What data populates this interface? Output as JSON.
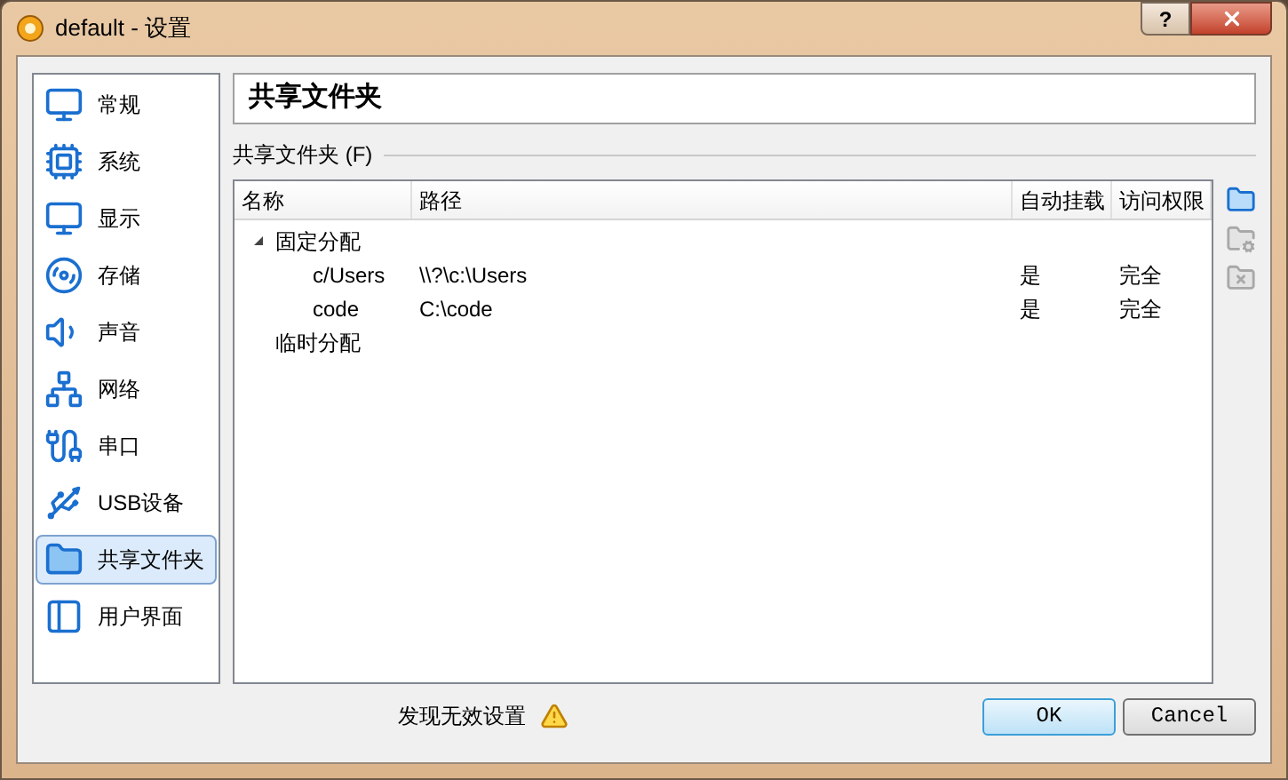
{
  "window": {
    "title": "default - 设置",
    "help_button": "?"
  },
  "sidebar": {
    "items": [
      {
        "label": "常规",
        "kind": "general",
        "selected": false
      },
      {
        "label": "系统",
        "kind": "system",
        "selected": false
      },
      {
        "label": "显示",
        "kind": "display",
        "selected": false
      },
      {
        "label": "存储",
        "kind": "storage",
        "selected": false
      },
      {
        "label": "声音",
        "kind": "audio",
        "selected": false
      },
      {
        "label": "网络",
        "kind": "network",
        "selected": false
      },
      {
        "label": "串口",
        "kind": "serial",
        "selected": false
      },
      {
        "label": "USB设备",
        "kind": "usb",
        "selected": false
      },
      {
        "label": "共享文件夹",
        "kind": "folder",
        "selected": true
      },
      {
        "label": "用户界面",
        "kind": "ui",
        "selected": false
      }
    ]
  },
  "page_title": "共享文件夹",
  "section_label": "共享文件夹 (F)",
  "table": {
    "columns": [
      "名称",
      "路径",
      "自动挂载",
      "访问权限"
    ],
    "groups": [
      {
        "label": "固定分配",
        "children": [
          {
            "name": "c/Users",
            "path": "\\\\?\\c:\\Users",
            "auto_mount": "是",
            "access": "完全"
          },
          {
            "name": "code",
            "path": "C:\\code",
            "auto_mount": "是",
            "access": "完全"
          }
        ]
      },
      {
        "label": "临时分配"
      }
    ]
  },
  "table_actions": [
    {
      "kind": "add",
      "disabled": false
    },
    {
      "kind": "edit",
      "disabled": true
    },
    {
      "kind": "remove",
      "disabled": true
    }
  ],
  "footer": {
    "warning": "发现无效设置",
    "buttons": [
      {
        "label": "OK",
        "default": true
      },
      {
        "label": "Cancel",
        "default": false
      }
    ]
  }
}
